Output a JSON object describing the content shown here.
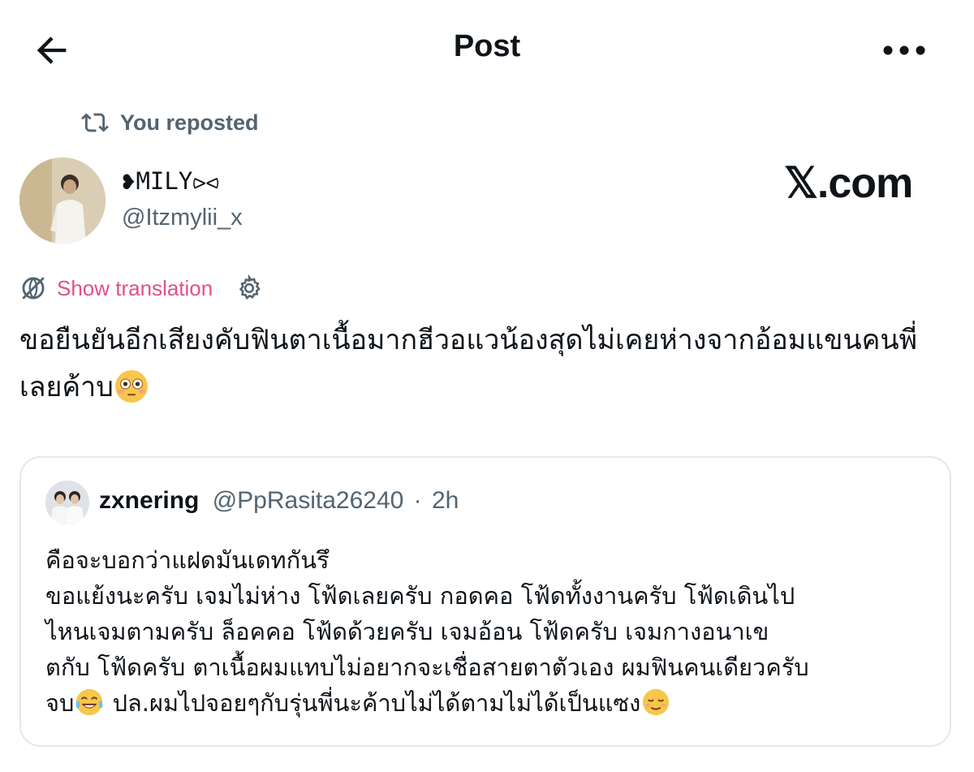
{
  "header": {
    "title": "Post",
    "back_icon": "arrow-left-icon",
    "more_icon": "more-horizontal-icon"
  },
  "repost": {
    "icon": "repost-icon",
    "label": "You reposted"
  },
  "post": {
    "author_name": "❥MILY⪧⪦",
    "author_handle": "@Itzmylii_x",
    "watermark": "𝕏.com",
    "show_translation_label": "Show translation",
    "text": "ขอยืนยันอีกเสียงคับฟินตาเนื้อมากฮีวอแวน้องสุดไม่เคยห่างจากอ้อมแขนคนพี่เลยค้าบ",
    "trailing_emoji": "flushed-face"
  },
  "quote": {
    "name": "zxnering",
    "handle": "@PpRasita26240",
    "separator": "·",
    "time": "2h",
    "lines": [
      "คือจะบอกว่าแฝดมันเดทกันรึ",
      "ขอแย้งนะครับ เจมไม่ห่าง โฟ้ดเลยครับ กอดคอ โฟ้ดทั้งงานครับ โฟ้ดเดินไป",
      "ไหนเจมตามครับ ล็อคคอ โฟ้ดด้วยครับ เจมอ้อน โฟ้ดครับ เจมกางอนาเข",
      "ตกับ โฟ้ดครับ ตาเนื้อผมแทบไม่อยากจะเชื่อสายตาตัวเอง ผมฟินคนเดียวครับ"
    ],
    "last_line_start": "จบ",
    "last_line_end": " ปล.ผมไปจอยๆกับรุ่นพี่นะค้าบไม่ได้ตามไม่ได้เป็นแซง"
  },
  "colors": {
    "text": "#0f1419",
    "secondary": "#536471",
    "translate_link": "#e0508a",
    "border": "#e1e8ed"
  }
}
